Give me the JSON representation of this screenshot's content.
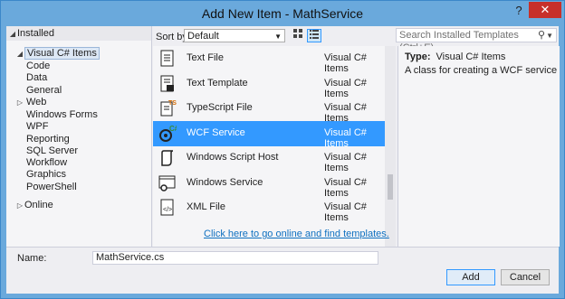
{
  "window": {
    "title": "Add New Item - MathService",
    "help_glyph": "?",
    "close_glyph": "✕"
  },
  "left_tree": {
    "installed": "Installed",
    "visual_csharp_items": "Visual C# Items",
    "children": [
      "Code",
      "Data",
      "General",
      "Web",
      "Windows Forms",
      "WPF",
      "Reporting",
      "SQL Server",
      "Workflow"
    ],
    "graphics": "Graphics",
    "powershell": "PowerShell",
    "online": "Online"
  },
  "toolbar": {
    "sort_label": "Sort by:",
    "sort_value": "Default"
  },
  "search": {
    "placeholder": "Search Installed Templates (Ctrl+E)"
  },
  "templates": [
    {
      "name": "Text File",
      "lang": "Visual C# Items",
      "icon": "text-file-icon"
    },
    {
      "name": "Text Template",
      "lang": "Visual C# Items",
      "icon": "text-template-icon"
    },
    {
      "name": "TypeScript File",
      "lang": "Visual C# Items",
      "icon": "typescript-file-icon"
    },
    {
      "name": "WCF Service",
      "lang": "Visual C# Items",
      "icon": "wcf-service-icon",
      "selected": true
    },
    {
      "name": "Windows Script Host",
      "lang": "Visual C# Items",
      "icon": "script-host-icon"
    },
    {
      "name": "Windows Service",
      "lang": "Visual C# Items",
      "icon": "windows-service-icon"
    },
    {
      "name": "XML File",
      "lang": "Visual C# Items",
      "icon": "xml-file-icon"
    }
  ],
  "online_link": "Click here to go online and find templates.",
  "details": {
    "type_label": "Type:",
    "type_value": "Visual C# Items",
    "description": "A class for creating a WCF service"
  },
  "bottom": {
    "name_label": "Name:",
    "name_value": "MathService.cs",
    "add_label": "Add",
    "cancel_label": "Cancel"
  },
  "colors": {
    "accent": "#3399ff",
    "link": "#0e70c0",
    "title_bar": "#6aa9dc",
    "close": "#c7302a"
  }
}
